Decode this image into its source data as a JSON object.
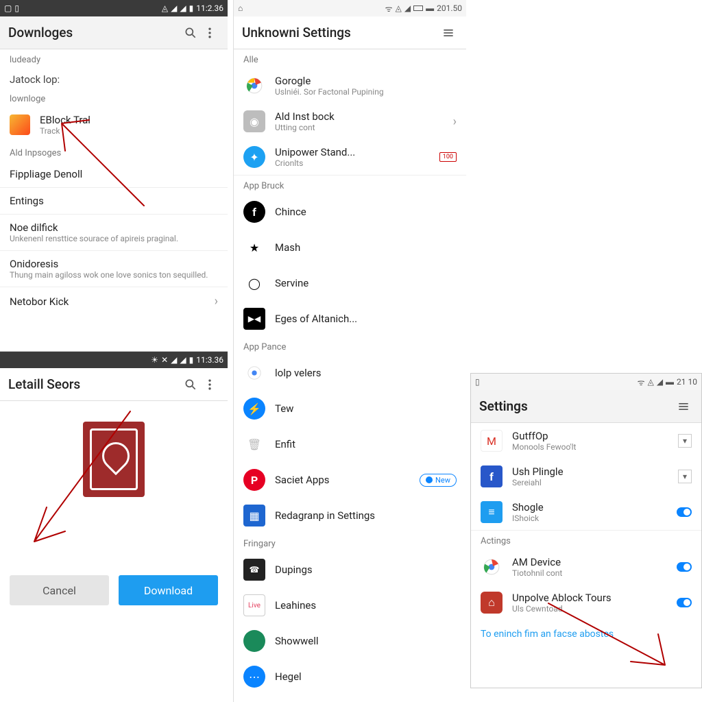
{
  "panel_a": {
    "status_time": "11:2.36",
    "title": "Downloges",
    "sec1": "ludeady",
    "sec2": "Jatock lop:",
    "sec3": "lownloge",
    "item_block": {
      "title": "EBlock Tral",
      "sub": "Track"
    },
    "sec4": "Ald Inpsoges",
    "rows": [
      {
        "title": "Fippliage Denoll",
        "sub": ""
      },
      {
        "title": "Entings",
        "sub": ""
      },
      {
        "title": "Noe dilfick",
        "sub": "Unkenenl rensttice sourace of apireis praginal."
      },
      {
        "title": "Onidoresis",
        "sub": "Thung main agiloss wok one love sonics ton sequilled."
      },
      {
        "title": "Netobor Kick",
        "sub": ""
      }
    ]
  },
  "panel_b": {
    "status_time": "11:3.36",
    "title": "Letaill Seors",
    "cancel": "Cancel",
    "download": "Download"
  },
  "panel_c": {
    "status_time": "201.50",
    "title": "Unknowni Settings",
    "sec_alle": "Alle",
    "apps_top": [
      {
        "title": "Gorogle",
        "sub": "Uslniéi. Sor Factonal Pupining",
        "icon": "chrome"
      },
      {
        "title": "Ald Inst bock",
        "sub": "Utting cont",
        "icon": "camera",
        "chevron": true
      },
      {
        "title": "Unipower Stand...",
        "sub": "Crionlts",
        "icon": "twitter",
        "badge": "100"
      }
    ],
    "sec_appbruck": "App Bruck",
    "apps_mid": [
      {
        "title": "Chince",
        "icon": "facebook"
      },
      {
        "title": "Mash",
        "icon": "star"
      },
      {
        "title": "Servine",
        "icon": "camera2"
      },
      {
        "title": "Eges of Altanich...",
        "icon": "video"
      }
    ],
    "sec_apppance": "App Pance",
    "apps_pance": [
      {
        "title": "lolp velers",
        "icon": "chrome2"
      },
      {
        "title": "Tew",
        "icon": "bolt"
      },
      {
        "title": "Enfit",
        "icon": "trash"
      },
      {
        "title": "Saciet Apps",
        "icon": "pinterest",
        "pill": "New"
      },
      {
        "title": "Redagranp in Settings",
        "icon": "calendar"
      }
    ],
    "sec_fringary": "Fringary",
    "apps_fring": [
      {
        "title": "Dupings",
        "icon": "phone"
      },
      {
        "title": "Leahines",
        "icon": "live"
      },
      {
        "title": "Showwell",
        "icon": "green"
      },
      {
        "title": "Hegel",
        "icon": "blue"
      }
    ]
  },
  "panel_d": {
    "status_time": "21 10",
    "title": "Settings",
    "rows_top": [
      {
        "title": "GutffOp",
        "sub": "Monools Fewoo'lt",
        "icon": "gmail",
        "ctrl": "drop"
      },
      {
        "title": "Ush Plingle",
        "sub": "Sereiahl",
        "icon": "bluef",
        "ctrl": "drop"
      },
      {
        "title": "Shogle",
        "sub": "IShoick",
        "icon": "bluedoc",
        "ctrl": "toggle"
      }
    ],
    "sec_actings": "Actings",
    "rows_act": [
      {
        "title": "AM Device",
        "sub": "Tiotohnil cont",
        "icon": "chrome",
        "ctrl": "toggle"
      },
      {
        "title": "Unpolve Ablock Tours",
        "sub": "Uls Cewntoad",
        "icon": "redapp",
        "ctrl": "toggle"
      }
    ],
    "footer_link": "To eninch fim an facse abostes"
  }
}
